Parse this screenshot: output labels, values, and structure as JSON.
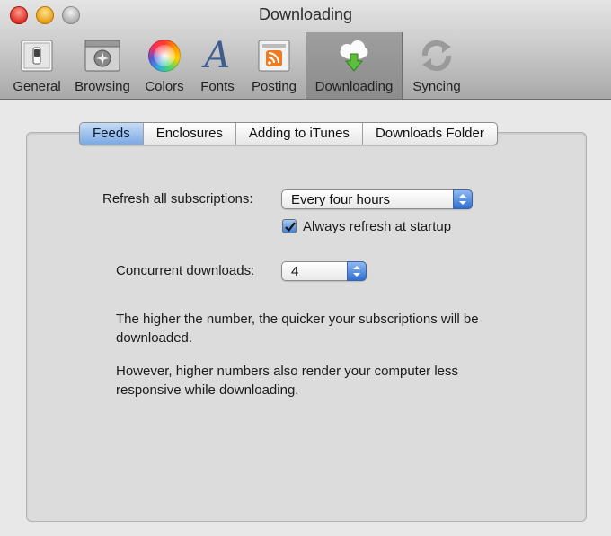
{
  "window": {
    "title": "Downloading"
  },
  "toolbar": {
    "items": [
      {
        "label": "General",
        "icon": "switch-icon"
      },
      {
        "label": "Browsing",
        "icon": "browser-window-icon"
      },
      {
        "label": "Colors",
        "icon": "color-wheel-icon"
      },
      {
        "label": "Fonts",
        "icon": "font-letter-a-icon"
      },
      {
        "label": "Posting",
        "icon": "rss-icon"
      },
      {
        "label": "Downloading",
        "icon": "cloud-download-icon",
        "selected": true
      },
      {
        "label": "Syncing",
        "icon": "sync-arrows-icon"
      }
    ]
  },
  "tabs": [
    {
      "label": "Feeds",
      "selected": true
    },
    {
      "label": "Enclosures"
    },
    {
      "label": "Adding to iTunes"
    },
    {
      "label": "Downloads Folder"
    }
  ],
  "feeds": {
    "refresh_label": "Refresh all subscriptions:",
    "refresh_value": "Every four hours",
    "startup_checkbox_label": "Always refresh at startup",
    "startup_checked": true,
    "concurrent_label": "Concurrent downloads:",
    "concurrent_value": "4",
    "help_text_1": "The higher the number, the quicker your subscriptions will be downloaded.",
    "help_text_2": "However, higher numbers also render your computer less responsive while downloading."
  },
  "colors": {
    "accent": "#3f7fd8",
    "selected_tab": "#7aa9e4"
  }
}
